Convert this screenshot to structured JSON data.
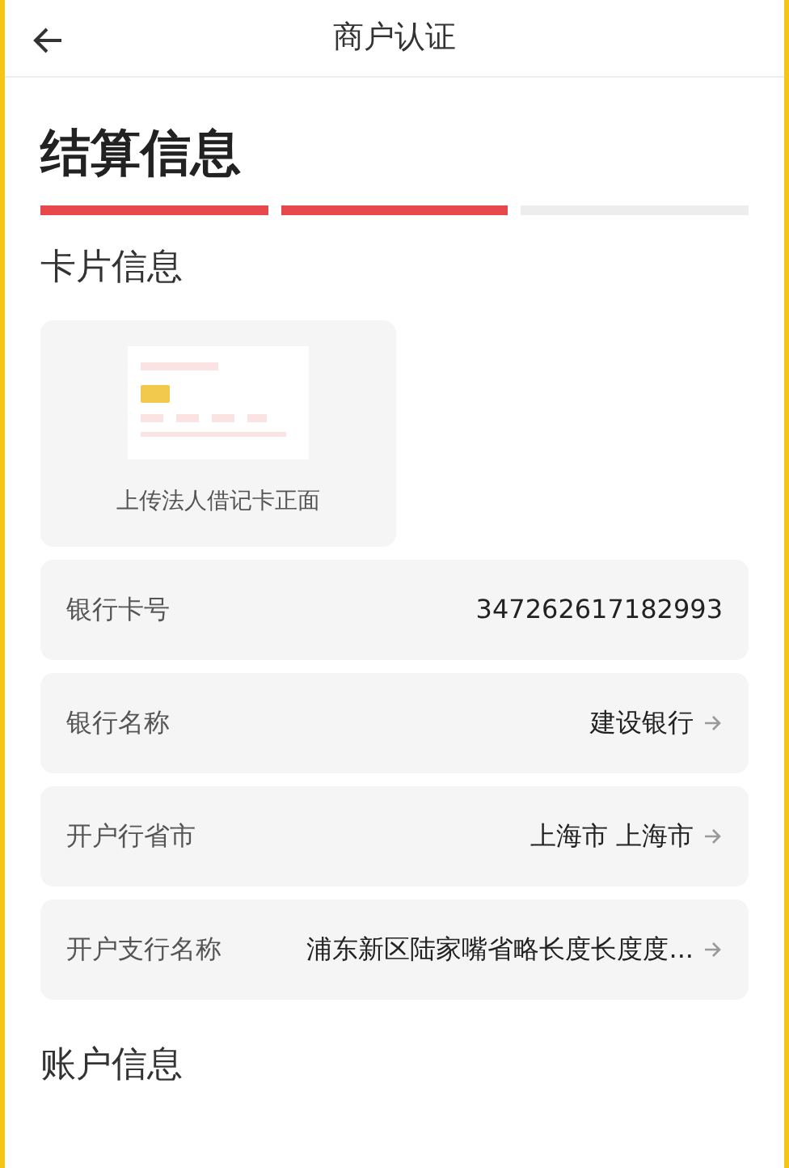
{
  "header": {
    "title": "商户认证"
  },
  "page_title": "结算信息",
  "steps": [
    {
      "completed": true
    },
    {
      "completed": true
    },
    {
      "completed": false
    }
  ],
  "card_section": {
    "title": "卡片信息",
    "upload_label": "上传法人借记卡正面"
  },
  "fields": [
    {
      "kind": "input",
      "label": "银行卡号",
      "value": "347262617182993"
    },
    {
      "kind": "select",
      "label": "银行名称",
      "value": "建设银行"
    },
    {
      "kind": "select",
      "label": "开户行省市",
      "value": "上海市 上海市"
    },
    {
      "kind": "select",
      "label": "开户支行名称",
      "value": "浦东新区陆家嘴省略长度长度度..."
    }
  ],
  "next_section": {
    "title": "账户信息"
  }
}
